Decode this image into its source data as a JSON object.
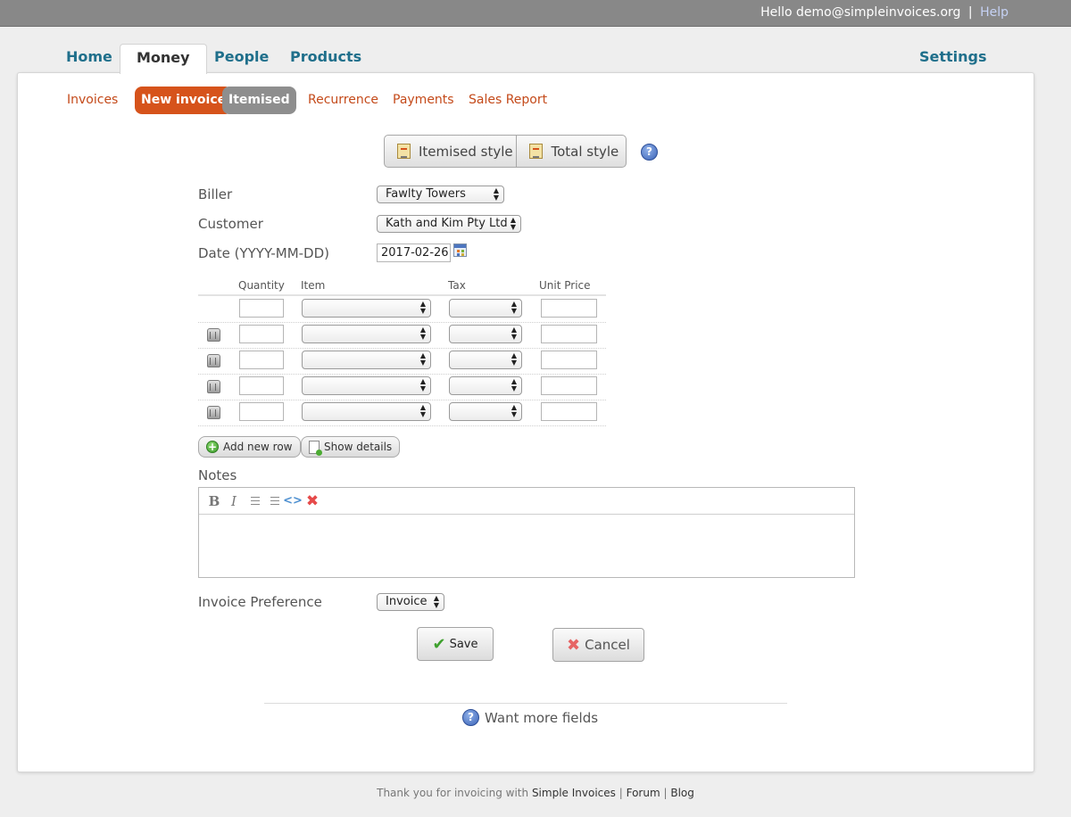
{
  "topbar": {
    "greeting": "Hello demo@simpleinvoices.org",
    "separator": "|",
    "help": "Help"
  },
  "main_tabs": {
    "home": "Home",
    "money": "Money",
    "people": "People",
    "products": "Products",
    "settings": "Settings"
  },
  "sub_tabs": {
    "invoices": "Invoices",
    "new_invoice": "New invoice",
    "itemised": "Itemised",
    "recurrence": "Recurrence",
    "payments": "Payments",
    "sales_report": "Sales Report"
  },
  "style_buttons": {
    "itemised": "Itemised style",
    "total": "Total style",
    "help_glyph": "?"
  },
  "form": {
    "biller_label": "Biller",
    "biller_value": "Fawlty Towers",
    "customer_label": "Customer",
    "customer_value": "Kath and Kim Pty Ltd",
    "date_label": "Date (YYYY-MM-DD)",
    "date_value": "2017-02-26"
  },
  "items_table": {
    "columns": {
      "quantity": "Quantity",
      "item": "Item",
      "tax": "Tax",
      "unit_price": "Unit Price"
    },
    "row_count": 5
  },
  "actions": {
    "add_row": "Add new row",
    "show_details": "Show details"
  },
  "notes": {
    "label": "Notes",
    "toolbar": [
      "B",
      "I",
      "ordered-list",
      "unordered-list",
      "<>",
      "✖"
    ]
  },
  "preference": {
    "label": "Invoice Preference",
    "value": "Invoice"
  },
  "buttons": {
    "save": "Save",
    "cancel": "Cancel"
  },
  "more_fields": "Want more fields",
  "footer": {
    "prefix": "Thank you for invoicing with",
    "simple_invoices": "Simple Invoices",
    "sep": "|",
    "forum": "Forum",
    "blog": "Blog"
  },
  "colors": {
    "topbar": "#888888",
    "tab_link": "#1f6f8b",
    "subtab_link": "#c44a1a",
    "active_pill": "#d6531b",
    "inactive_pill": "#8e8e8e"
  }
}
